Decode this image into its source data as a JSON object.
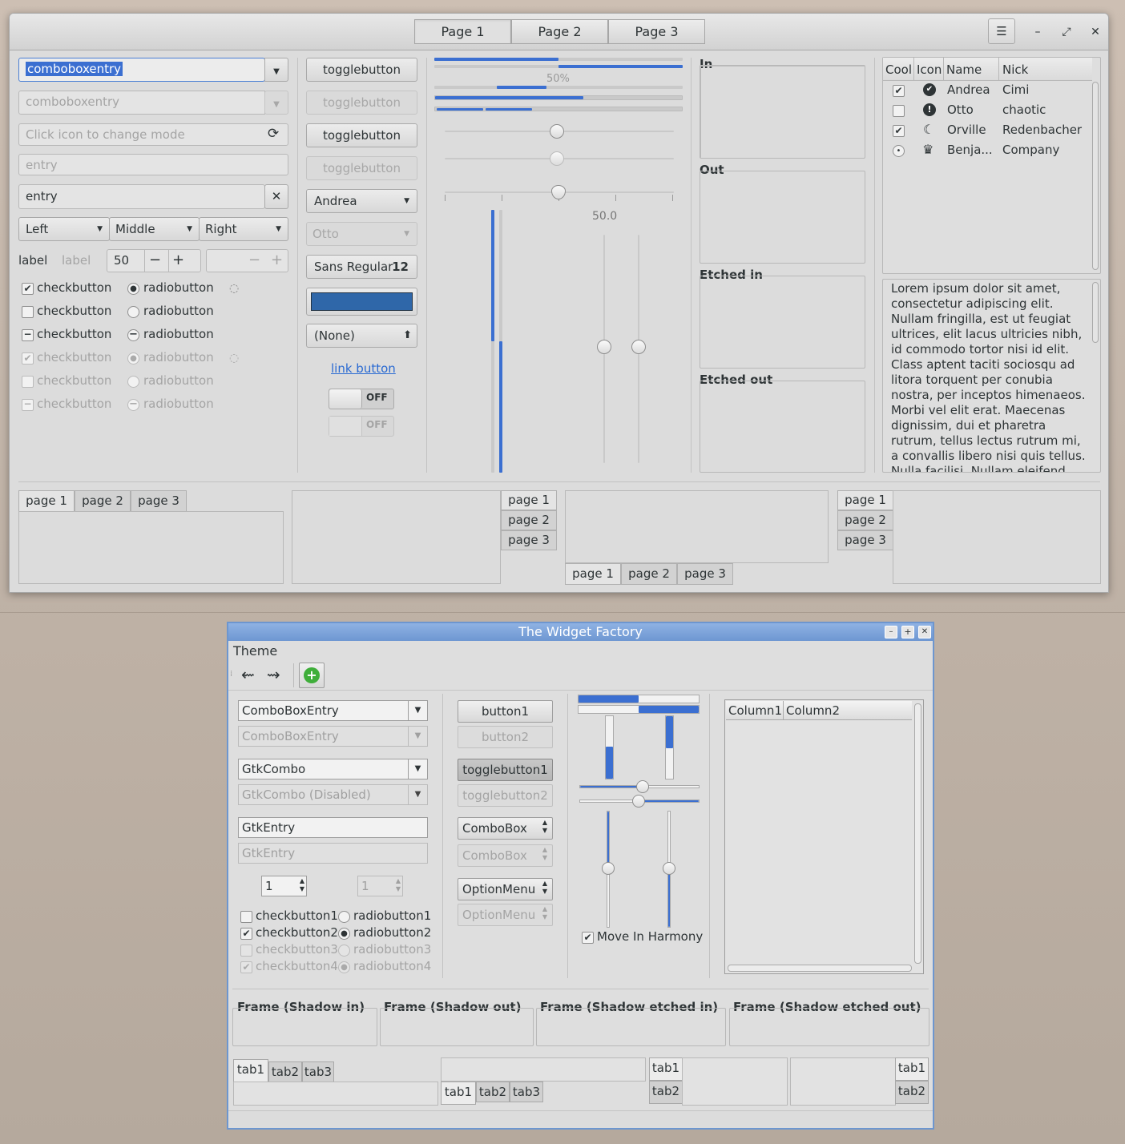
{
  "gtk3": {
    "header_tabs": [
      "Page 1",
      "Page 2",
      "Page 3"
    ],
    "window_buttons": {
      "menu": "☰",
      "minimize": "–",
      "maximize": "⤢",
      "close": "✕"
    },
    "combo_entry_1": "comboboxentry",
    "combo_entry_2": "comboboxentry",
    "entry_icon_placeholder": "Click icon to change mode",
    "entry_disabled": "entry",
    "entry_clear": "entry",
    "linked_buttons": [
      "Left",
      "Middle",
      "Right"
    ],
    "label_1": "label",
    "label_2": "label",
    "spin_value": "50",
    "checkbuttons": [
      "checkbutton",
      "checkbutton",
      "checkbutton",
      "checkbutton",
      "checkbutton",
      "checkbutton"
    ],
    "radiobuttons": [
      "radiobutton",
      "radiobutton",
      "radiobutton",
      "radiobutton",
      "radiobutton",
      "radiobutton"
    ],
    "togglebuttons": [
      "togglebutton",
      "togglebutton",
      "togglebutton",
      "togglebutton"
    ],
    "combo_andrea": "Andrea",
    "combo_otto": "Otto",
    "font_button": {
      "name": "Sans Regular",
      "size": "12"
    },
    "color_button": "#2f67a9",
    "file_button": "(None)",
    "link_button": "link button",
    "switch_label": "OFF",
    "progress_label": "50%",
    "scale_value": "50.0",
    "progress_values": {
      "bar1": 0.5,
      "bar2": 0.5,
      "bar3": 0.2
    },
    "frames": [
      "In",
      "Out",
      "Etched in",
      "Etched out"
    ],
    "tree": {
      "columns": [
        "Cool",
        "Icon",
        "Name",
        "Nick"
      ],
      "rows": [
        {
          "cool": "✔",
          "icon": "✔",
          "name": "Andrea",
          "nick": "Cimi"
        },
        {
          "cool": "",
          "icon": "!",
          "name": "Otto",
          "nick": "chaotic"
        },
        {
          "cool": "✔",
          "icon": "☾",
          "name": "Orville",
          "nick": "Redenbacher"
        },
        {
          "cool": "•",
          "icon": "♛",
          "name": "Benja...",
          "nick": "Company"
        }
      ]
    },
    "lorem": "Lorem ipsum dolor sit amet, consectetur adipiscing elit. Nullam fringilla, est ut feugiat ultrices, elit lacus ultricies nibh, id commodo tortor nisi id elit. Class aptent taciti sociosqu ad litora torquent per conubia nostra, per inceptos himenaeos. Morbi vel elit erat. Maecenas dignissim, dui et pharetra rutrum, tellus lectus rutrum mi, a convallis libero nisi quis tellus. Nulla facilisi. Nullam eleifend",
    "notebook_tabs": [
      "page 1",
      "page 2",
      "page 3"
    ]
  },
  "gtk2": {
    "title": "The Widget Factory",
    "menu": "Theme",
    "combo_entry": "ComboBoxEntry",
    "combo_entry_dis": "ComboBoxEntry",
    "gtkcombo": "GtkCombo",
    "gtkcombo_dis": "GtkCombo (Disabled)",
    "entry": "GtkEntry",
    "entry_dis": "GtkEntry",
    "spin1": "1",
    "spin2": "1",
    "checks": [
      "checkbutton1",
      "checkbutton2",
      "checkbutton3",
      "checkbutton4"
    ],
    "radios": [
      "radiobutton1",
      "radiobutton2",
      "radiobutton3",
      "radiobutton4"
    ],
    "buttons": [
      "button1",
      "button2"
    ],
    "toggles": [
      "togglebutton1",
      "togglebutton2"
    ],
    "combobox": [
      "ComboBox",
      "ComboBox"
    ],
    "optionmenu": [
      "OptionMenu",
      "OptionMenu"
    ],
    "harmony": "Move In Harmony",
    "columns": [
      "Column1",
      "Column2"
    ],
    "frames": [
      "Frame (Shadow in)",
      "Frame (Shadow out)",
      "Frame (Shadow etched in)",
      "Frame (Shadow etched out)"
    ],
    "tabs": [
      "tab1",
      "tab2",
      "tab3"
    ]
  }
}
